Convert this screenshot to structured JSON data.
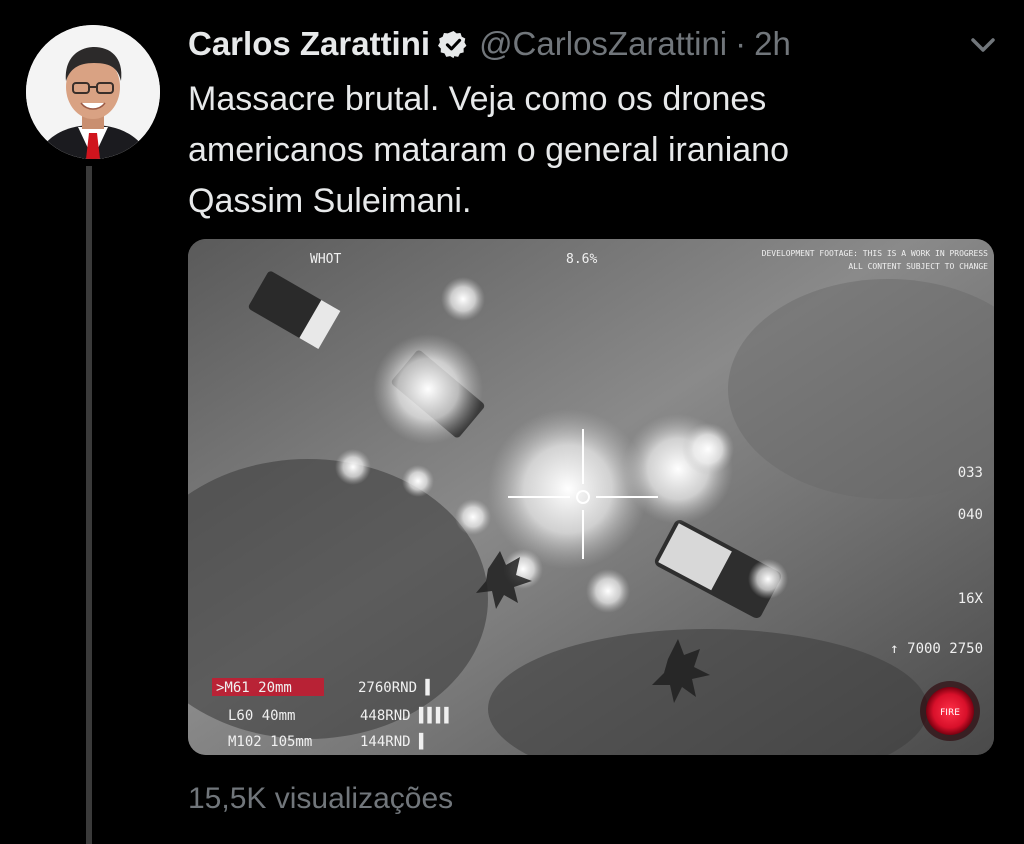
{
  "tweet": {
    "author_name": "Carlos Zarattini",
    "handle": "@CarlosZarattini",
    "separator": "·",
    "time": "2h",
    "verified": true,
    "text": "Massacre brutal. Veja como os drones\namericanos mataram o general iraniano\nQassim Suleimani.",
    "views": "15,5K visualizações"
  },
  "media": {
    "hud": {
      "top_left": "WHOT",
      "top_center": "8.6%",
      "notice_line1": "DEVELOPMENT FOOTAGE: THIS IS A WORK IN PROGRESS",
      "notice_line2": "ALL CONTENT SUBJECT TO CHANGE",
      "right_1": "033",
      "right_2": "040",
      "right_3": "16X",
      "right_4": "↑ 7000 2750",
      "weapon_1": ">M61 20mm",
      "ammo_1": "2760RND ▌",
      "weapon_2": "L60 40mm",
      "ammo_2": "448RND ▌▌▌▌",
      "weapon_3": "M102 105mm",
      "ammo_3": "144RND ▌",
      "fire_label": "FIRE"
    }
  },
  "icons": {
    "verified": "verified-badge-icon",
    "more": "chevron-down-icon"
  },
  "colors": {
    "background": "#000000",
    "primary_text": "#e7e9ea",
    "secondary_text": "#71767b",
    "fire_button": "#d8102a"
  }
}
